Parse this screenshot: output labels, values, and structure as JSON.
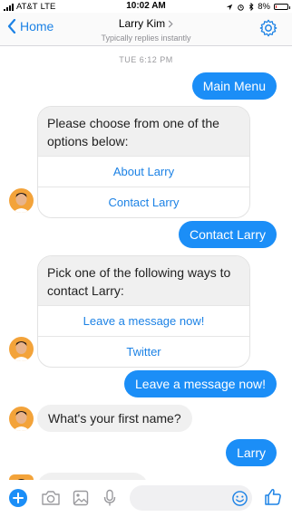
{
  "status_bar": {
    "carrier": "AT&T",
    "network": "LTE",
    "time": "10:02 AM",
    "battery": "8%",
    "battery_level": 0.08
  },
  "header": {
    "back_label": "Home",
    "title": "Larry Kim",
    "subtitle": "Typically replies instantly"
  },
  "timestamp": "TUE 6:12 PM",
  "messages": {
    "out1": "Main Menu",
    "card1": {
      "prompt": "Please choose from one of the options below:",
      "options": [
        "About Larry",
        "Contact Larry"
      ]
    },
    "out2": "Contact Larry",
    "card2": {
      "prompt": "Pick one of the following ways to contact Larry:",
      "options": [
        "Leave a message now!",
        "Twitter"
      ]
    },
    "out3": "Leave a message now!",
    "in1": "What's your first name?",
    "out4": "Larry"
  },
  "composer": {
    "placeholder": ""
  },
  "colors": {
    "accent": "#1b8ef7",
    "link": "#1c82e5",
    "incoming_bg": "#f0f0f0"
  },
  "icons": [
    "chevron-left-icon",
    "chevron-right-icon",
    "gear-icon",
    "plus-icon",
    "camera-icon",
    "image-icon",
    "microphone-icon",
    "emoji-icon",
    "thumbs-up-icon"
  ]
}
